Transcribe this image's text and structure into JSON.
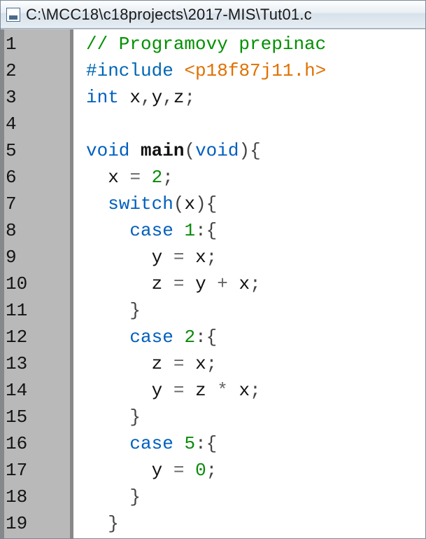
{
  "window": {
    "title": "C:\\MCC18\\c18projects\\2017-MIS\\Tut01.c"
  },
  "editor": {
    "gutter_start": 1,
    "gutter_end": 19,
    "code_lines": [
      [
        {
          "class": "tok-comment",
          "text": "// Programovy prepinac"
        }
      ],
      [
        {
          "class": "tok-pp",
          "text": "#include"
        },
        {
          "class": null,
          "text": " "
        },
        {
          "class": "tok-include",
          "text": "<p18f87j11.h>"
        }
      ],
      [
        {
          "class": "tok-kw",
          "text": "int"
        },
        {
          "class": null,
          "text": " "
        },
        {
          "class": "tok-ident",
          "text": "x"
        },
        {
          "class": "tok-punct",
          "text": ","
        },
        {
          "class": "tok-ident",
          "text": "y"
        },
        {
          "class": "tok-punct",
          "text": ","
        },
        {
          "class": "tok-ident",
          "text": "z"
        },
        {
          "class": "tok-punct",
          "text": ";"
        }
      ],
      [],
      [
        {
          "class": "tok-kw",
          "text": "void"
        },
        {
          "class": null,
          "text": " "
        },
        {
          "class": "tok-func",
          "text": "main"
        },
        {
          "class": "tok-paren",
          "text": "("
        },
        {
          "class": "tok-kw",
          "text": "void"
        },
        {
          "class": "tok-paren",
          "text": ")"
        },
        {
          "class": "tok-brace",
          "text": "{"
        }
      ],
      [
        {
          "class": null,
          "text": "  "
        },
        {
          "class": "tok-ident",
          "text": "x"
        },
        {
          "class": null,
          "text": " "
        },
        {
          "class": "tok-op",
          "text": "="
        },
        {
          "class": null,
          "text": " "
        },
        {
          "class": "tok-num",
          "text": "2"
        },
        {
          "class": "tok-punct",
          "text": ";"
        }
      ],
      [
        {
          "class": null,
          "text": "  "
        },
        {
          "class": "tok-kw",
          "text": "switch"
        },
        {
          "class": "tok-paren",
          "text": "("
        },
        {
          "class": "tok-ident",
          "text": "x"
        },
        {
          "class": "tok-paren",
          "text": ")"
        },
        {
          "class": "tok-brace",
          "text": "{"
        }
      ],
      [
        {
          "class": null,
          "text": "    "
        },
        {
          "class": "tok-kw",
          "text": "case"
        },
        {
          "class": null,
          "text": " "
        },
        {
          "class": "tok-num",
          "text": "1"
        },
        {
          "class": "tok-punct",
          "text": ":"
        },
        {
          "class": "tok-brace",
          "text": "{"
        }
      ],
      [
        {
          "class": null,
          "text": "      "
        },
        {
          "class": "tok-ident",
          "text": "y"
        },
        {
          "class": null,
          "text": " "
        },
        {
          "class": "tok-op",
          "text": "="
        },
        {
          "class": null,
          "text": " "
        },
        {
          "class": "tok-ident",
          "text": "x"
        },
        {
          "class": "tok-punct",
          "text": ";"
        }
      ],
      [
        {
          "class": null,
          "text": "      "
        },
        {
          "class": "tok-ident",
          "text": "z"
        },
        {
          "class": null,
          "text": " "
        },
        {
          "class": "tok-op",
          "text": "="
        },
        {
          "class": null,
          "text": " "
        },
        {
          "class": "tok-ident",
          "text": "y"
        },
        {
          "class": null,
          "text": " "
        },
        {
          "class": "tok-op",
          "text": "+"
        },
        {
          "class": null,
          "text": " "
        },
        {
          "class": "tok-ident",
          "text": "x"
        },
        {
          "class": "tok-punct",
          "text": ";"
        }
      ],
      [
        {
          "class": null,
          "text": "    "
        },
        {
          "class": "tok-brace",
          "text": "}"
        }
      ],
      [
        {
          "class": null,
          "text": "    "
        },
        {
          "class": "tok-kw",
          "text": "case"
        },
        {
          "class": null,
          "text": " "
        },
        {
          "class": "tok-num",
          "text": "2"
        },
        {
          "class": "tok-punct",
          "text": ":"
        },
        {
          "class": "tok-brace",
          "text": "{"
        }
      ],
      [
        {
          "class": null,
          "text": "      "
        },
        {
          "class": "tok-ident",
          "text": "z"
        },
        {
          "class": null,
          "text": " "
        },
        {
          "class": "tok-op",
          "text": "="
        },
        {
          "class": null,
          "text": " "
        },
        {
          "class": "tok-ident",
          "text": "x"
        },
        {
          "class": "tok-punct",
          "text": ";"
        }
      ],
      [
        {
          "class": null,
          "text": "      "
        },
        {
          "class": "tok-ident",
          "text": "y"
        },
        {
          "class": null,
          "text": " "
        },
        {
          "class": "tok-op",
          "text": "="
        },
        {
          "class": null,
          "text": " "
        },
        {
          "class": "tok-ident",
          "text": "z"
        },
        {
          "class": null,
          "text": " "
        },
        {
          "class": "tok-op",
          "text": "*"
        },
        {
          "class": null,
          "text": " "
        },
        {
          "class": "tok-ident",
          "text": "x"
        },
        {
          "class": "tok-punct",
          "text": ";"
        }
      ],
      [
        {
          "class": null,
          "text": "    "
        },
        {
          "class": "tok-brace",
          "text": "}"
        }
      ],
      [
        {
          "class": null,
          "text": "    "
        },
        {
          "class": "tok-kw",
          "text": "case"
        },
        {
          "class": null,
          "text": " "
        },
        {
          "class": "tok-num",
          "text": "5"
        },
        {
          "class": "tok-punct",
          "text": ":"
        },
        {
          "class": "tok-brace",
          "text": "{"
        }
      ],
      [
        {
          "class": null,
          "text": "      "
        },
        {
          "class": "tok-ident",
          "text": "y"
        },
        {
          "class": null,
          "text": " "
        },
        {
          "class": "tok-op",
          "text": "="
        },
        {
          "class": null,
          "text": " "
        },
        {
          "class": "tok-num",
          "text": "0"
        },
        {
          "class": "tok-punct",
          "text": ";"
        }
      ],
      [
        {
          "class": null,
          "text": "    "
        },
        {
          "class": "tok-brace",
          "text": "}"
        }
      ],
      [
        {
          "class": null,
          "text": "  "
        },
        {
          "class": "tok-brace",
          "text": "}"
        }
      ]
    ]
  }
}
